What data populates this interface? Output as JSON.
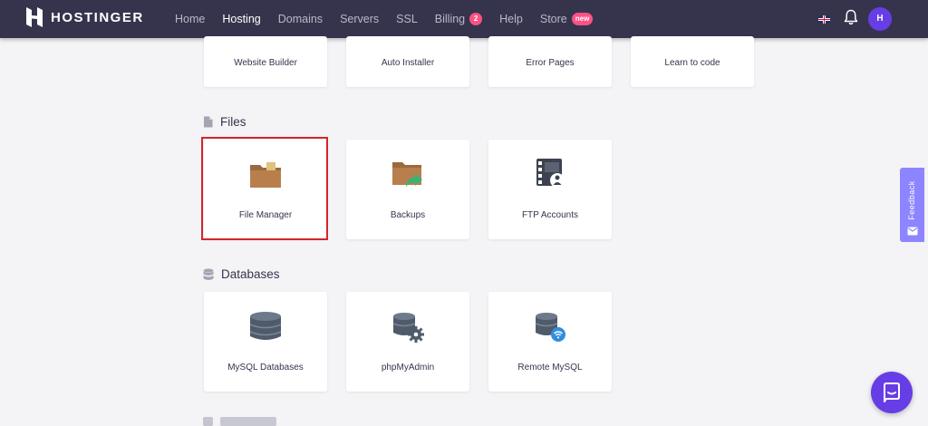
{
  "brand": {
    "name": "HOSTINGER"
  },
  "nav": {
    "items": [
      {
        "label": "Home"
      },
      {
        "label": "Hosting"
      },
      {
        "label": "Domains"
      },
      {
        "label": "Servers"
      },
      {
        "label": "SSL"
      },
      {
        "label": "Billing",
        "badge": "2"
      },
      {
        "label": "Help"
      },
      {
        "label": "Store",
        "badge": "new"
      }
    ],
    "active": "Hosting",
    "avatar_initial": "H"
  },
  "top_cards": [
    {
      "label": "Website Builder"
    },
    {
      "label": "Auto Installer"
    },
    {
      "label": "Error Pages"
    },
    {
      "label": "Learn to code"
    }
  ],
  "sections": {
    "files": {
      "title": "Files",
      "cards": [
        {
          "label": "File Manager",
          "icon": "folder-icon"
        },
        {
          "label": "Backups",
          "icon": "folder-backup-icon"
        },
        {
          "label": "FTP Accounts",
          "icon": "ftp-accounts-icon"
        }
      ]
    },
    "databases": {
      "title": "Databases",
      "cards": [
        {
          "label": "MySQL Databases",
          "icon": "database-icon"
        },
        {
          "label": "phpMyAdmin",
          "icon": "database-gear-icon"
        },
        {
          "label": "Remote MySQL",
          "icon": "database-remote-icon"
        }
      ]
    }
  },
  "widgets": {
    "feedback_label": "Feedback"
  },
  "colors": {
    "topbar": "#36344d",
    "accent": "#673de6",
    "highlight": "#d3262b",
    "badge": "#fc5185"
  }
}
